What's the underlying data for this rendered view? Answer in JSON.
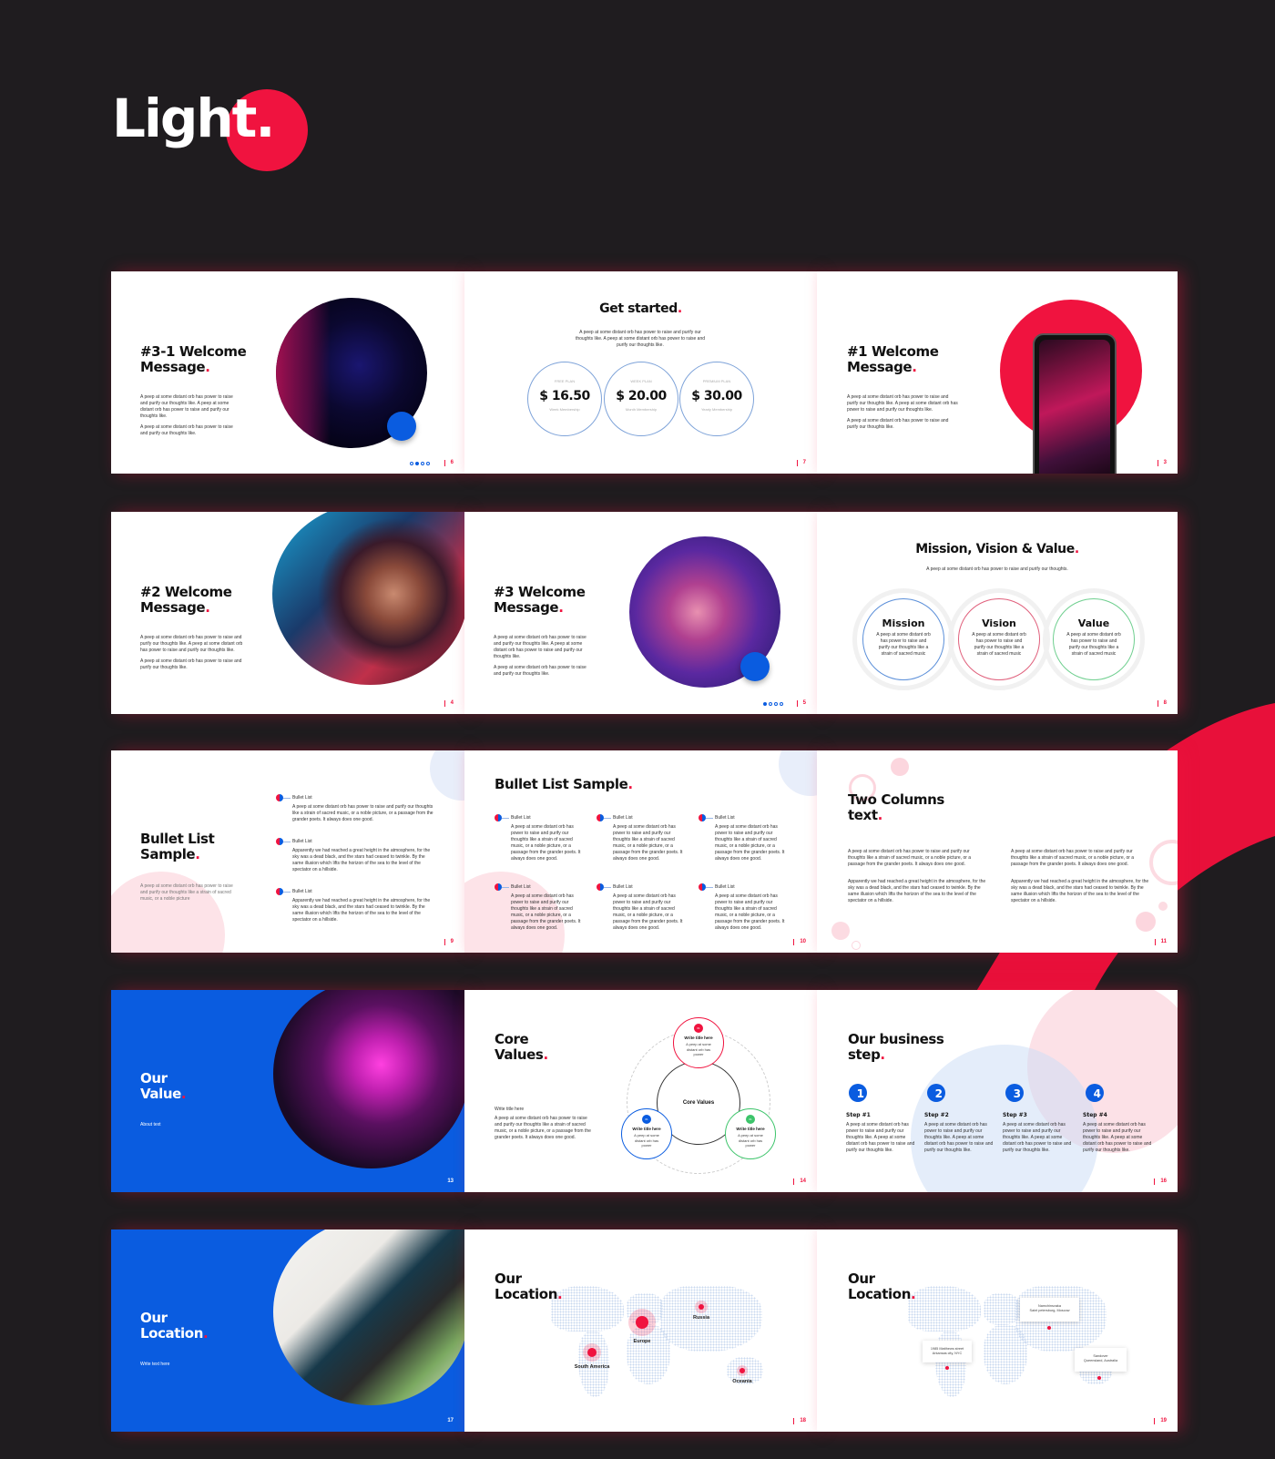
{
  "header": {
    "title": "Light",
    "title_dot": "."
  },
  "colors": {
    "accent": "#f0133f",
    "blue": "#0a5ce0",
    "background": "#1f1c1f"
  },
  "slides": {
    "welcome_3_1": {
      "title_1": "#3-1 Welcome",
      "title_2": "Message",
      "dot": ".",
      "body_1": "A peep at some distant orb has power to raise and purify our thoughts like. A peep at some distant orb has power to raise and purify our thoughts like.",
      "body_2": "A peep at some distant orb has power to raise and purify our thoughts like.",
      "page": "6"
    },
    "get_started": {
      "title": "Get started",
      "dot": ".",
      "body": "A peep at some distant orb has power to raise and purify our thoughts like. A peep at some distant orb has power to raise and purify our thoughts like.",
      "plans": [
        {
          "label": "FREE PLAN",
          "price": "$ 16.50",
          "term": "Week Membership"
        },
        {
          "label": "WEEK PLAN",
          "price": "$ 20.00",
          "term": "Month Membership"
        },
        {
          "label": "PREMIUM PLAN",
          "price": "$ 30.00",
          "term": "Yearly Membership"
        }
      ],
      "page": "7"
    },
    "welcome_1": {
      "title_1": "#1 Welcome",
      "title_2": "Message",
      "dot": ".",
      "body_1": "A peep at some distant orb has power to raise and purify our thoughts like. A peep at some distant orb has power to raise and purify our thoughts like.",
      "body_2": "A peep at some distant orb has power to raise and purify our thoughts like.",
      "page": "3"
    },
    "welcome_2": {
      "title_1": "#2 Welcome",
      "title_2": "Message",
      "dot": ".",
      "body_1": "A peep at some distant orb has power to raise and purify our thoughts like. A peep at some distant orb has power to raise and purify our thoughts like.",
      "body_2": "A peep at some distant orb has power to raise and purify our thoughts like.",
      "page": "4"
    },
    "welcome_3": {
      "title_1": "#3 Welcome",
      "title_2": "Message",
      "dot": ".",
      "body_1": "A peep at some distant orb has power to raise and purify our thoughts like. A peep at some distant orb has power to raise and purify our thoughts like.",
      "body_2": "A peep at some distant orb has power to raise and purify our thoughts like.",
      "page": "5"
    },
    "mission": {
      "title": "Mission, Vision & Value",
      "dot": ".",
      "subtitle": "A peep at some distant orb has power to raise and purify our thoughts.",
      "items": [
        {
          "title": "Mission",
          "body": "A peep at some distant orb has power to raise and purify our thoughts like a strain of sacred music",
          "color": "#5b8fd9"
        },
        {
          "title": "Vision",
          "body": "A peep at some distant orb has power to raise and purify our thoughts like a strain of sacred music",
          "color": "#e0607c"
        },
        {
          "title": "Value",
          "body": "A peep at some distant orb has power to raise and purify our thoughts like a strain of sacred music",
          "color": "#6fcf8f"
        }
      ],
      "page": "8"
    },
    "bullet_1": {
      "title_1": "Bullet List",
      "title_2": "Sample",
      "dot": ".",
      "body": "A peep at some distant orb has power to raise and purify our thoughts like a strain of sacred music, or a noble picture",
      "items": [
        {
          "label": "Bullet List",
          "body": "A peep at some distant orb has power to raise and purify our thoughts like a strain of sacred music, or a noble picture, or a passage from the grander poets. It always does one good."
        },
        {
          "label": "Bullet List",
          "body": "Apparently we had reached a great height in the atmosphere, for the sky was a dead black, and the stars had ceased to twinkle. By the same illusion which lifts the horizon of the sea to the level of the spectator on a hillside."
        },
        {
          "label": "Bullet List",
          "body": "Apparently we had reached a great height in the atmosphere, for the sky was a dead black, and the stars had ceased to twinkle. By the same illusion which lifts the horizon of the sea to the level of the spectator on a hillside."
        }
      ],
      "page": "9"
    },
    "bullet_2": {
      "title": "Bullet List Sample",
      "dot": ".",
      "item_label": "Bullet List",
      "item_body": "A peep at some distant orb has power to raise and purify our thoughts like a strain of sacred music, or a noble picture, or a passage from the grander poets. It always does one good.",
      "page": "10"
    },
    "two_columns": {
      "title_1": "Two Columns",
      "title_2": "text",
      "dot": ".",
      "para_1": "A peep at some distant orb has power to raise and purify our thoughts like a strain of sacred music, or a noble picture, or a passage from the grander poets. It always does one good.",
      "para_2": "Apparently we had reached a great height in the atmosphere, for the sky was a dead black, and the stars had ceased to twinkle. By the same illusion which lifts the horizon of the sea to the level of the spectator on a hillside.",
      "page": "11"
    },
    "our_value": {
      "title_1": "Our",
      "title_2": "Value",
      "dot": ".",
      "body": "About text",
      "page": "13"
    },
    "core_values": {
      "title_1": "Core",
      "title_2": "Values",
      "dot": ".",
      "subhead": "Write title here",
      "body": "A peep at some distant orb has power to raise and purify our thoughts like a strain of sacred music, or a noble picture, or a passage from the grander poets. It always does one good.",
      "center": "Core Values",
      "items": [
        {
          "num": "01",
          "title": "Write title here",
          "body": "A peep at some distant orb has power",
          "color": "#f0133f"
        },
        {
          "num": "01",
          "title": "Write title here",
          "body": "A peep at some distant orb has power",
          "color": "#0a5ce0"
        },
        {
          "num": "01",
          "title": "Write title here",
          "body": "A peep at some distant orb has power",
          "color": "#3cc46a"
        }
      ],
      "page": "14"
    },
    "business_step": {
      "title_1": "Our business",
      "title_2": "step",
      "dot": ".",
      "steps": [
        {
          "num": "1",
          "title": "Step #1",
          "body": "A peep at some distant orb has power to raise and purify our thoughts like. A peep at some distant orb has power to raise and purify our thoughts like."
        },
        {
          "num": "2",
          "title": "Step #2",
          "body": "A peep at some distant orb has power to raise and purify our thoughts like. A peep at some distant orb has power to raise and purify our thoughts like."
        },
        {
          "num": "3",
          "title": "Step #3",
          "body": "A peep at some distant orb has power to raise and purify our thoughts like. A peep at some distant orb has power to raise and purify our thoughts like."
        },
        {
          "num": "4",
          "title": "Step #4",
          "body": "A peep at some distant orb has power to raise and purify our thoughts like. A peep at some distant orb has power to raise and purify our thoughts like."
        }
      ],
      "page": "16"
    },
    "location_blue": {
      "title_1": "Our",
      "title_2": "Location",
      "dot": ".",
      "body": "Write text here",
      "page": "17"
    },
    "location_map": {
      "title_1": "Our",
      "title_2": "Location",
      "dot": ".",
      "markers": [
        "Europe",
        "Russia",
        "South America",
        "Oceania"
      ],
      "page": "18"
    },
    "location_callouts": {
      "title_1": "Our",
      "title_2": "Location",
      "dot": ".",
      "callouts": [
        {
          "line_1": "Namchinsvaka",
          "line_2": "Saint petersburg, Moscow"
        },
        {
          "line_1": "1985 Matthews street",
          "line_2": "Arkansas city, NYC"
        },
        {
          "line_1": "Sandover",
          "line_2": "Queensland, Australia"
        }
      ],
      "page": "19"
    }
  }
}
